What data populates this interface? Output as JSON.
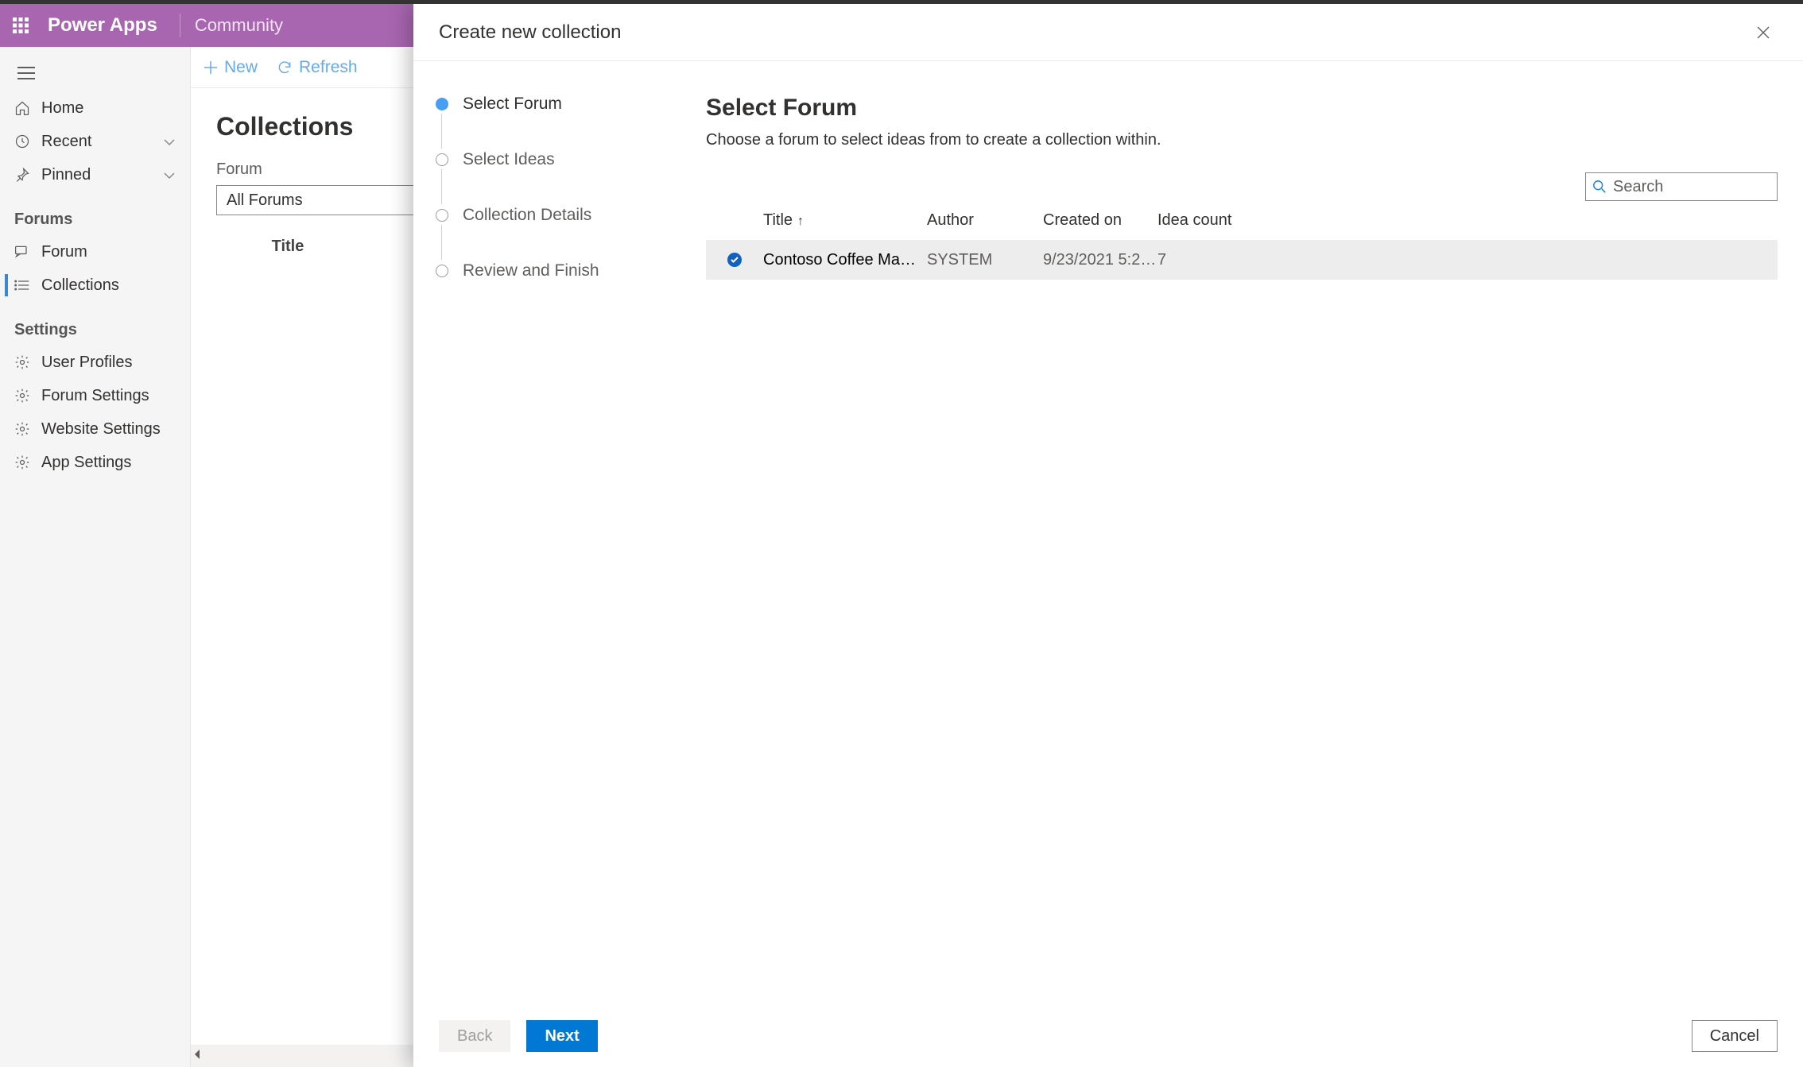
{
  "app": {
    "name": "Power Apps",
    "section": "Community"
  },
  "sidebar": {
    "home": "Home",
    "recent": "Recent",
    "pinned": "Pinned",
    "group_forums": "Forums",
    "forum": "Forum",
    "collections": "Collections",
    "group_settings": "Settings",
    "user_profiles": "User Profiles",
    "forum_settings": "Forum Settings",
    "website_settings": "Website Settings",
    "app_settings": "App Settings"
  },
  "cmdbar": {
    "new": "New",
    "refresh": "Refresh"
  },
  "collections_page": {
    "title": "Collections",
    "forum_label": "Forum",
    "forum_value": "All Forums",
    "column_title": "Title"
  },
  "modal": {
    "title": "Create new collection",
    "steps": [
      "Select Forum",
      "Select Ideas",
      "Collection Details",
      "Review and Finish"
    ],
    "right_heading": "Select Forum",
    "right_desc": "Choose a forum to select ideas from to create a collection within.",
    "search_placeholder": "Search",
    "table": {
      "columns": {
        "title": "Title",
        "author": "Author",
        "created": "Created on",
        "ideacount": "Idea count"
      },
      "rows": [
        {
          "title": "Contoso Coffee Mach…",
          "author": "SYSTEM",
          "created": "9/23/2021 5:2…",
          "ideacount": "7",
          "selected": true
        }
      ]
    },
    "buttons": {
      "back": "Back",
      "next": "Next",
      "cancel": "Cancel"
    }
  }
}
